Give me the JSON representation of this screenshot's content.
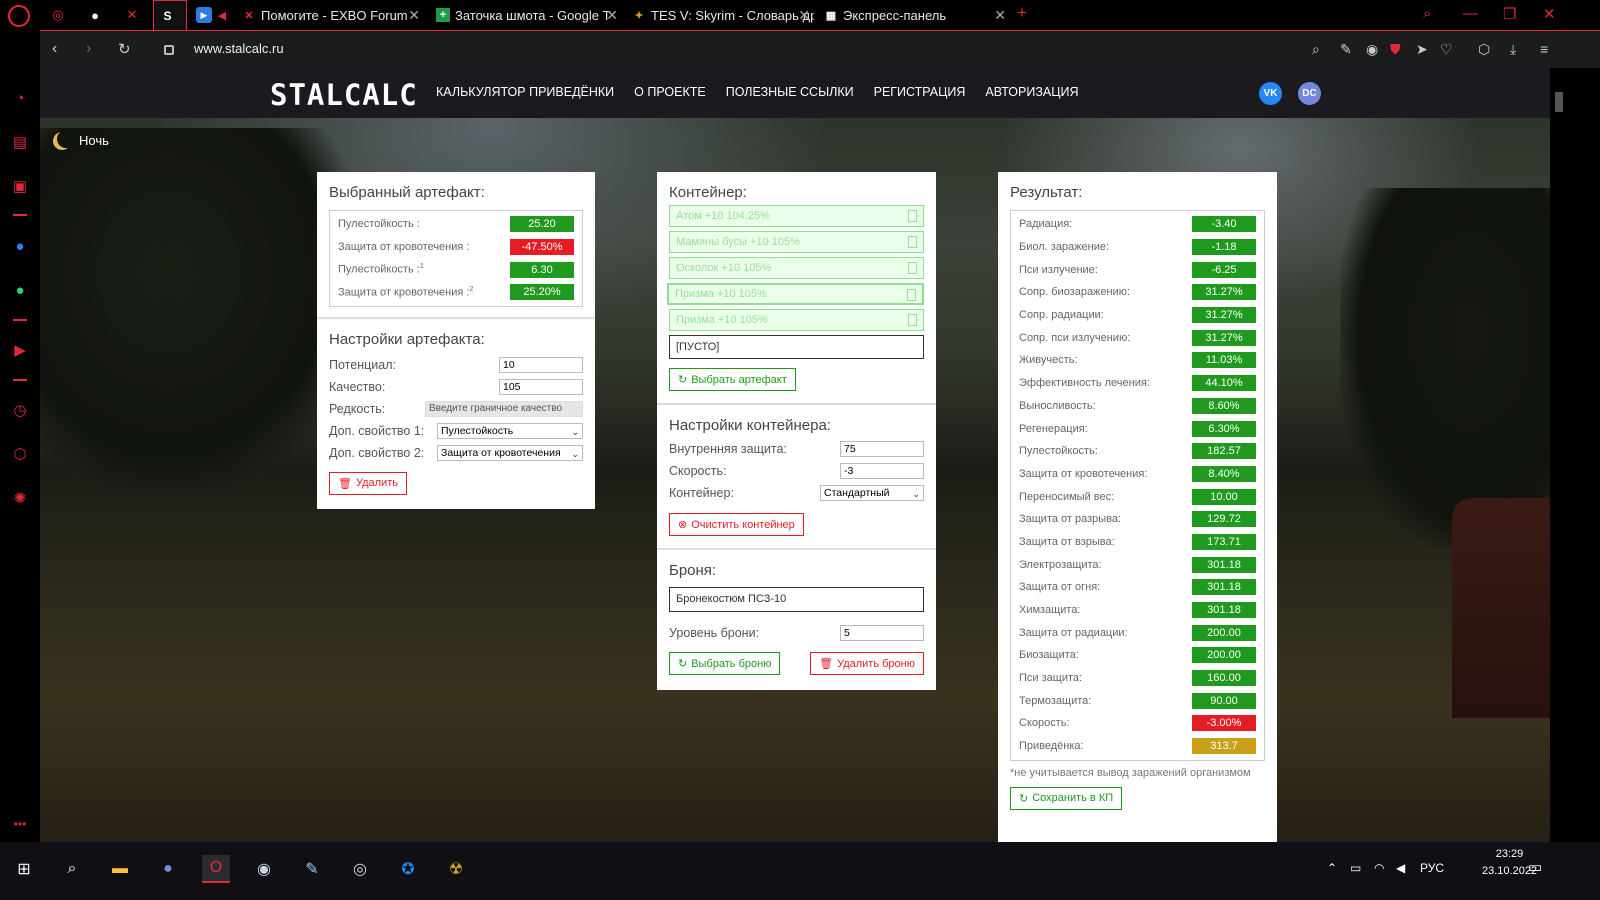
{
  "browser": {
    "tabs": [
      {
        "title": "Помогите - EXBO Forum"
      },
      {
        "title": "Заточка шмота - Google Т"
      },
      {
        "title": "TES V: Skyrim - Словарь др"
      },
      {
        "title": "Экспресс-панель"
      }
    ],
    "url": "www.stalcalc.ru"
  },
  "site": {
    "logo": "STALCALC",
    "menu": [
      "КАЛЬКУЛЯТОР ПРИВЕДЁНКИ",
      "О ПРОЕКТЕ",
      "ПОЛЕЗНЫЕ ССЫЛКИ",
      "РЕГИСТРАЦИЯ",
      "АВТОРИЗАЦИЯ"
    ],
    "social": {
      "vk": "VK",
      "discord": "DC"
    },
    "night_label": "Ночь"
  },
  "artifact": {
    "title": "Выбранный артефакт:",
    "stats": [
      {
        "label": "Пулестойкость :",
        "value": "25.20",
        "color": "green"
      },
      {
        "label": "Защита от кровотечения :",
        "value": "-47.50%",
        "color": "red"
      },
      {
        "label": "Пулестойкость :",
        "sup": "1",
        "value": "6.30",
        "color": "green"
      },
      {
        "label": "Защита от кровотечения :",
        "sup": "2",
        "value": "25.20%",
        "color": "green"
      }
    ],
    "settings_title": "Настройки артефакта:",
    "potential_label": "Потенциал:",
    "potential_value": "10",
    "quality_label": "Качество:",
    "quality_value": "105",
    "rarity_label": "Редкость:",
    "rarity_placeholder": "Введите граничное качество",
    "prop1_label": "Доп. свойство 1:",
    "prop1_value": "Пулестойкость",
    "prop2_label": "Доп. свойство 2:",
    "prop2_value": "Защита от кровотечения",
    "delete_label": "Удалить"
  },
  "container": {
    "title": "Контейнер:",
    "items": [
      "Атом +10 104.25%",
      "Мамины бусы +10 105%",
      "Осколок +10 105%",
      "Призма +10 105%",
      "Призма +10 105%"
    ],
    "empty_slot": "[ПУСТО]",
    "select_artifact_label": "Выбрать артефакт",
    "settings_title": "Настройки контейнера:",
    "inner_protection_label": "Внутренняя защита:",
    "inner_protection_value": "75",
    "speed_label": "Скорость:",
    "speed_value": "-3",
    "container_label": "Контейнер:",
    "container_value": "Стандартный",
    "clear_label": "Очистить контейнер"
  },
  "armor": {
    "title": "Броня:",
    "name": "Бронекостюм ПСЗ-10",
    "level_label": "Уровень брони:",
    "level_value": "5",
    "select_label": "Выбрать броню",
    "delete_label": "Удалить броню"
  },
  "result": {
    "title": "Результат:",
    "rows": [
      {
        "label": "Радиация:",
        "value": "-3.40",
        "color": "green"
      },
      {
        "label": "Биол. заражение:",
        "value": "-1.18",
        "color": "green"
      },
      {
        "label": "Пси излучение:",
        "value": "-6.25",
        "color": "green"
      },
      {
        "label": "Сопр. биозаражению:",
        "value": "31.27%",
        "color": "green"
      },
      {
        "label": "Сопр. радиации:",
        "value": "31.27%",
        "color": "green"
      },
      {
        "label": "Сопр. пси излучению:",
        "value": "31.27%",
        "color": "green"
      },
      {
        "label": "Живучесть:",
        "value": "11.03%",
        "color": "green"
      },
      {
        "label": "Эффективность лечения:",
        "value": "44.10%",
        "color": "green"
      },
      {
        "label": "Выносливость:",
        "value": "8.60%",
        "color": "green"
      },
      {
        "label": "Регенерация:",
        "value": "6.30%",
        "color": "green"
      },
      {
        "label": "Пулестойкость:",
        "value": "182.57",
        "color": "green"
      },
      {
        "label": "Защита от кровотечения:",
        "value": "8.40%",
        "color": "green"
      },
      {
        "label": "Переносимый вес:",
        "value": "10.00",
        "color": "green"
      },
      {
        "label": "Защита от разрыва:",
        "value": "129.72",
        "color": "green"
      },
      {
        "label": "Защита от взрыва:",
        "value": "173.71",
        "color": "green"
      },
      {
        "label": "Электрозащита:",
        "value": "301.18",
        "color": "green"
      },
      {
        "label": "Защита от огня:",
        "value": "301.18",
        "color": "green"
      },
      {
        "label": "Химзащита:",
        "value": "301.18",
        "color": "green"
      },
      {
        "label": "Защита от радиации:",
        "value": "200.00",
        "color": "green"
      },
      {
        "label": "Биозащита:",
        "value": "200.00",
        "color": "green"
      },
      {
        "label": "Пси защита:",
        "value": "160.00",
        "color": "green"
      },
      {
        "label": "Термозащита:",
        "value": "90.00",
        "color": "green"
      },
      {
        "label": "Скорость:",
        "value": "-3.00%",
        "color": "red"
      },
      {
        "label": "Приведёнка:",
        "value": "313.7",
        "color": "gold"
      }
    ],
    "note": "*не учитывается вывод заражений организмом",
    "save_label": "Сохранить в КП"
  },
  "taskbar": {
    "lang": "РУС",
    "time": "23:29",
    "date": "23.10.2022"
  },
  "colors": {
    "accent": "#e02a38",
    "green": "#1f9a1f",
    "red": "#e51c23",
    "gold": "#c8a11b"
  }
}
